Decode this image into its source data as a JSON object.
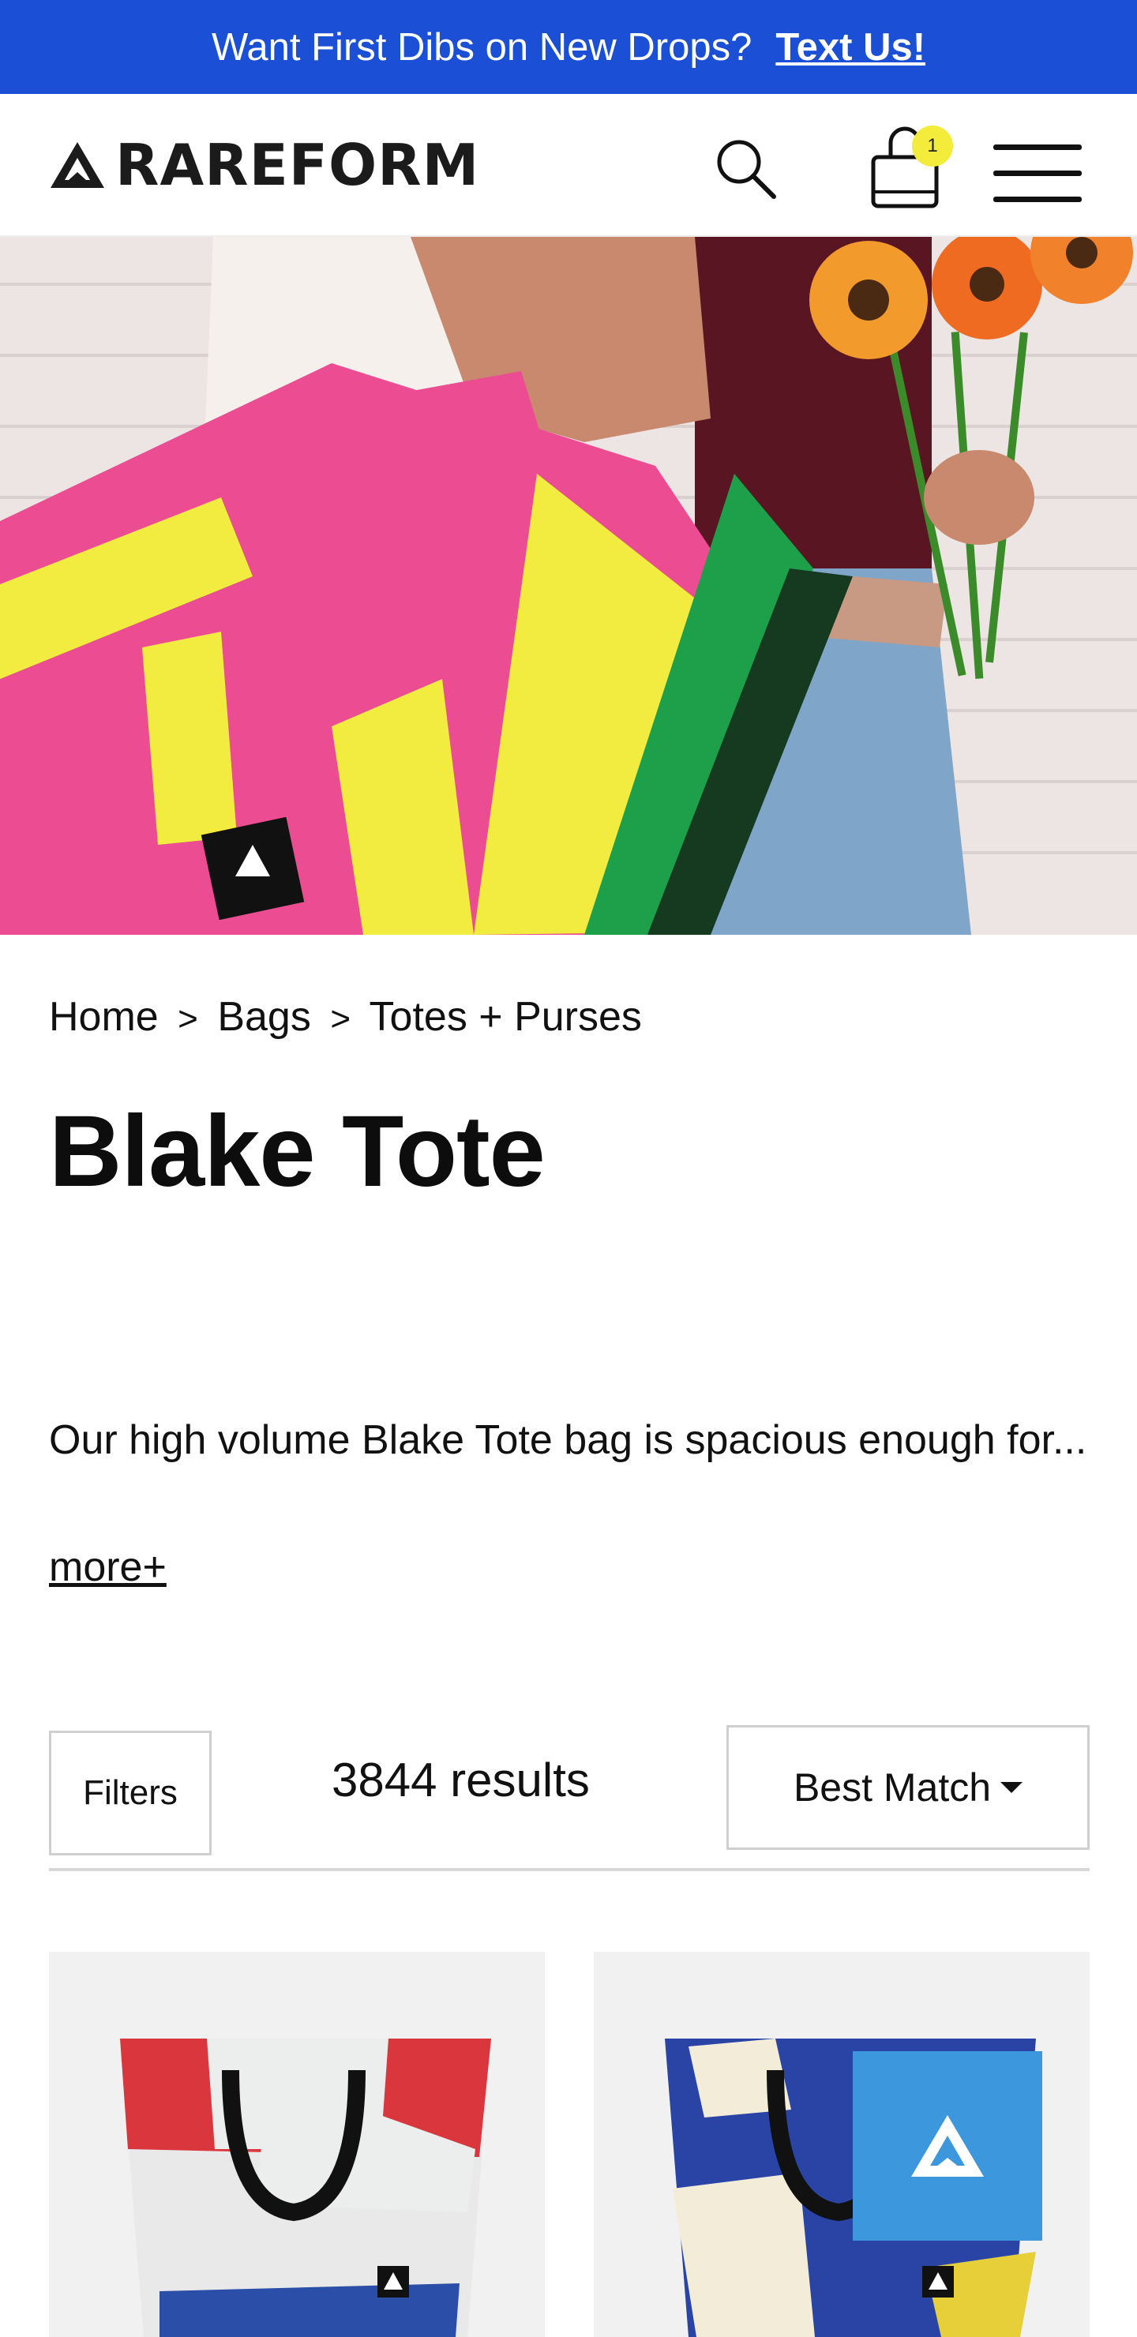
{
  "announcement": {
    "text": "Want First Dibs on New Drops?",
    "cta": "Text Us!",
    "background": "#1a4fd6"
  },
  "header": {
    "brand": "RAREFORM",
    "search_icon": "search-icon",
    "cart_icon": "shopping-bag-icon",
    "cart_count": "1",
    "menu_icon": "hamburger-menu-icon"
  },
  "breadcrumb": {
    "items": [
      "Home",
      "Bags",
      "Totes + Purses"
    ],
    "separator": ">"
  },
  "product": {
    "title": "Blake Tote",
    "description": "Our high volume Blake Tote bag is spacious enough for...",
    "more_link": "more+"
  },
  "toolbar": {
    "filters_label": "Filters",
    "results_text": "3844 results",
    "sort_label": "Best Match"
  },
  "colors": {
    "accent": "#1a4fd6",
    "badge": "#f3ec3b",
    "chat": "#3d97dc"
  }
}
